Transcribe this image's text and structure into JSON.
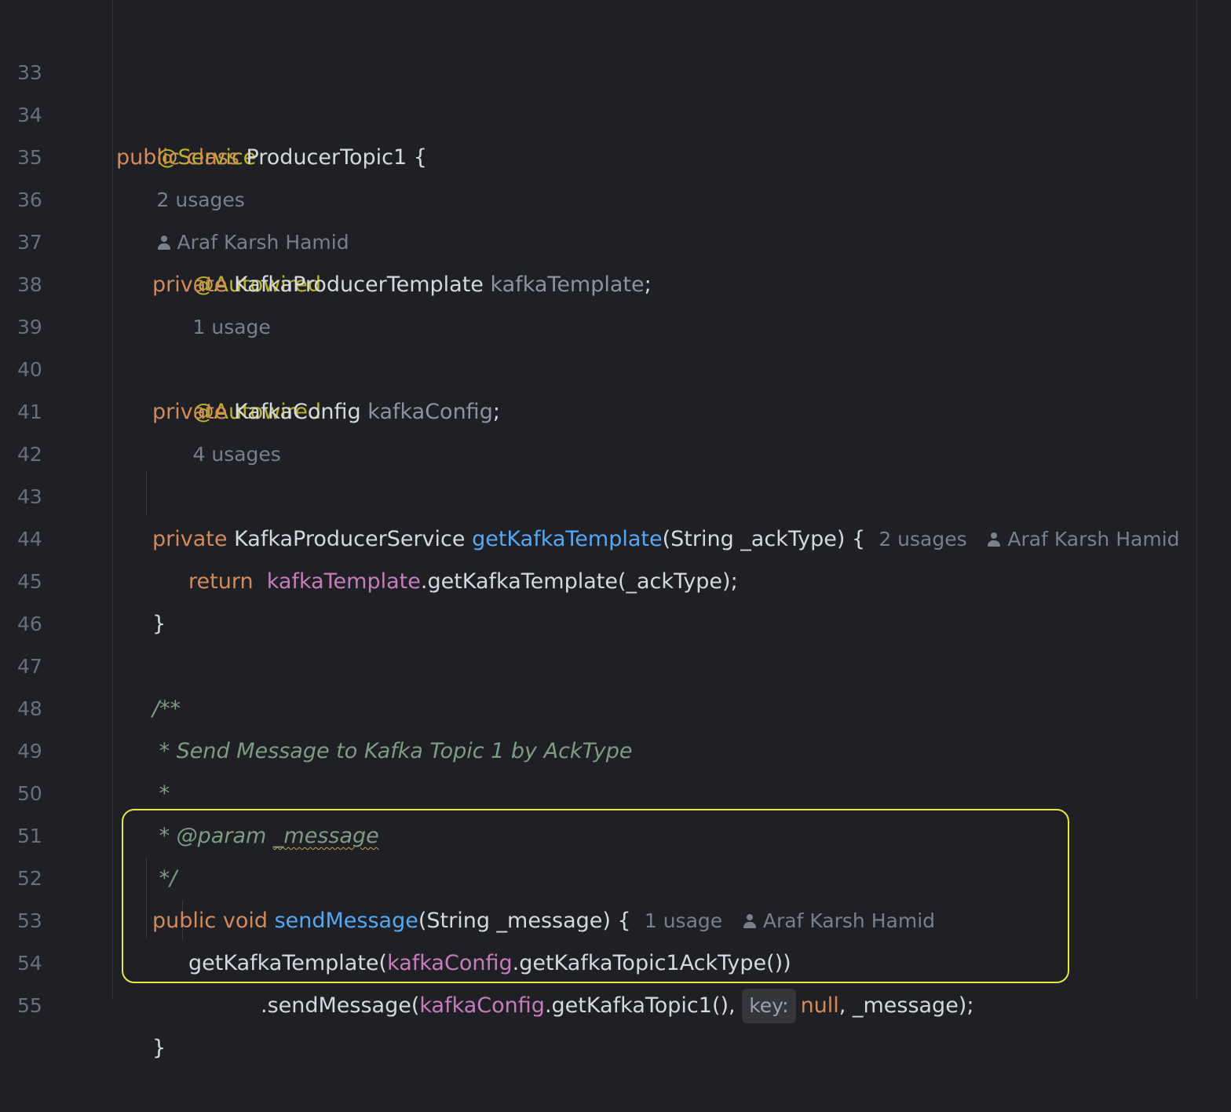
{
  "editor": {
    "lines": [
      {
        "n": "33"
      },
      {
        "n": "34"
      },
      {
        "n": "35"
      },
      {
        "n": "36"
      },
      {
        "n": "37"
      },
      {
        "n": "38"
      },
      {
        "n": "39"
      },
      {
        "n": "40"
      },
      {
        "n": "41"
      },
      {
        "n": "42"
      },
      {
        "n": "43"
      },
      {
        "n": "44"
      },
      {
        "n": "45"
      },
      {
        "n": "46"
      },
      {
        "n": "47"
      },
      {
        "n": "48"
      },
      {
        "n": "49"
      },
      {
        "n": "50"
      },
      {
        "n": "51"
      },
      {
        "n": "52"
      },
      {
        "n": "53"
      },
      {
        "n": "54"
      },
      {
        "n": "55"
      }
    ],
    "l33": {
      "annotation": "@Service",
      "usages": "2 usages",
      "author": "Araf Karsh Hamid"
    },
    "l34": {
      "kw1": "public",
      "kw2": "class",
      "name": "ProducerTopic1",
      "brace": "{"
    },
    "l36": {
      "annotation": "@Autowired",
      "usages": "1 usage"
    },
    "l37": {
      "kw": "private",
      "type": "KafkaProducerTemplate",
      "field": "kafkaTemplate",
      "semi": ";"
    },
    "l39": {
      "annotation": "@Autowired",
      "usages": "4 usages"
    },
    "l40": {
      "kw": "private",
      "type": "KafkaConfig",
      "field": "kafkaConfig",
      "semi": ";"
    },
    "l43": {
      "kw": "private",
      "type": "KafkaProducerService",
      "method": "getKafkaTemplate",
      "params": "(String _ackType) {",
      "usages": "2 usages",
      "author": "Araf Karsh Hamid"
    },
    "l44": {
      "kw": "return",
      "inst": "kafkaTemplate",
      "rest": ".getKafkaTemplate(_ackType);"
    },
    "l45": {
      "brace": "}"
    },
    "l47": {
      "text": "/**"
    },
    "l48": {
      "text": " * Send Message to Kafka Topic 1 by AckType"
    },
    "l49": {
      "text": " *"
    },
    "l50": {
      "prefix": " * ",
      "tag": "@param",
      "param": "_message"
    },
    "l51": {
      "text": " */"
    },
    "l52": {
      "kw1": "public",
      "kw2": "void",
      "method": "sendMessage",
      "params": "(String _message) {",
      "usages": "1 usage",
      "author": "Araf Karsh Hamid"
    },
    "l53": {
      "pre": "getKafkaTemplate(",
      "inst": "kafkaConfig",
      "rest": ".getKafkaTopic1AckType())"
    },
    "l54": {
      "pre": ".sendMessage(",
      "inst": "kafkaConfig",
      "mid": ".getKafkaTopic1(), ",
      "hint": "key:",
      "null": "null",
      "rest": ", _message);"
    },
    "l55": {
      "brace": "}"
    }
  }
}
